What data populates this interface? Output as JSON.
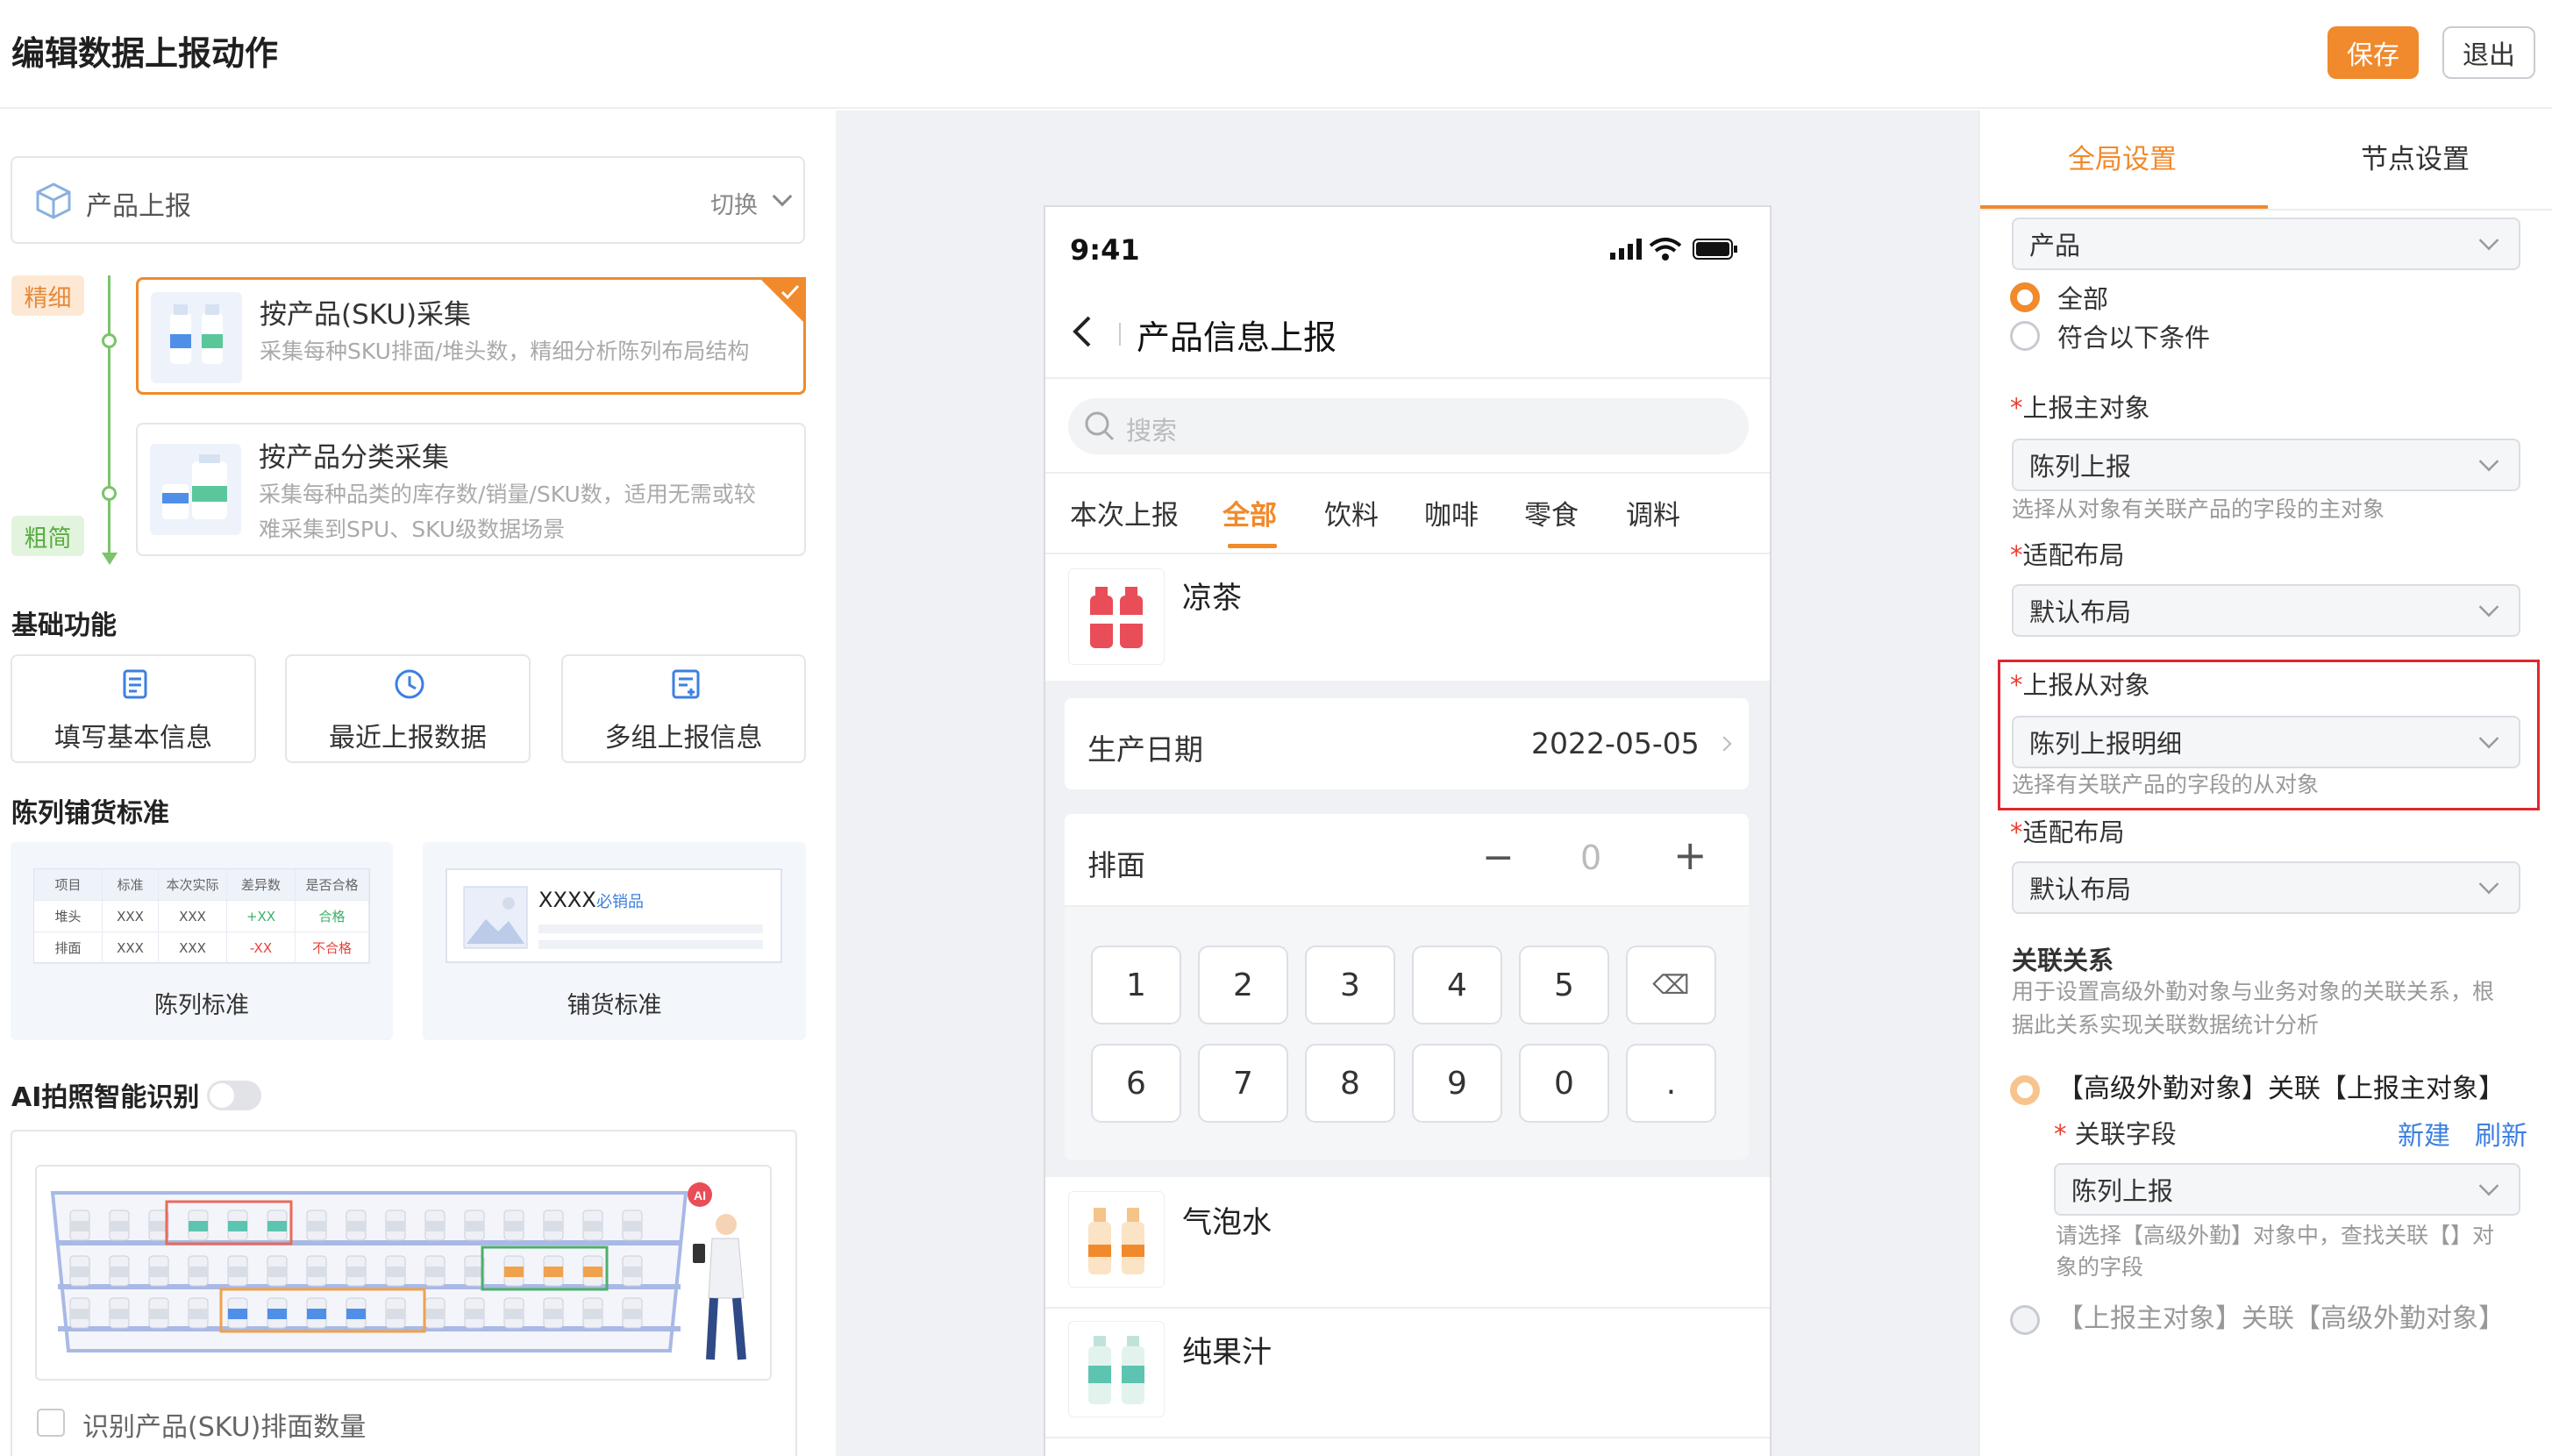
{
  "header": {
    "title": "编辑数据上报动作",
    "save": "保存",
    "exit": "退出"
  },
  "left": {
    "module": {
      "name": "产品上报",
      "switch": "切换"
    },
    "tag_fine": "精细",
    "tag_coarse": "粗简",
    "options": [
      {
        "title": "按产品(SKU)采集",
        "desc": "采集每种SKU排面/堆头数，精细分析陈列布局结构"
      },
      {
        "title": "按产品分类采集",
        "desc1": "采集每种品类的库存数/销量/SKU数，适用无需或较",
        "desc2": "难采集到SPU、SKU级数据场景"
      }
    ],
    "basic_title": "基础功能",
    "basic_buttons": [
      "填写基本信息",
      "最近上报数据",
      "多组上报信息"
    ],
    "display_title": "陈列铺货标准",
    "std_table": {
      "headers": [
        "项目",
        "标准",
        "本次实际",
        "差异数",
        "是否合格"
      ],
      "rows": [
        [
          "堆头",
          "XXX",
          "XXX",
          "+XX",
          "合格"
        ],
        [
          "排面",
          "XXX",
          "XXX",
          "-XX",
          "不合格"
        ]
      ]
    },
    "std_cards": [
      "陈列标准",
      "铺货标准"
    ],
    "dist_item": "XXXX",
    "dist_badge": "必销品",
    "ai_title": "AI拍照智能识别",
    "ai_badge": "AI",
    "ai_checkbox": "识别产品(SKU)排面数量"
  },
  "phone": {
    "time": "9:41",
    "title": "产品信息上报",
    "search_placeholder": "搜索",
    "tabs": [
      "本次上报",
      "全部",
      "饮料",
      "咖啡",
      "零食",
      "调料"
    ],
    "product1": "凉茶",
    "date_label": "生产日期",
    "date_value": "2022-05-05",
    "face_label": "排面",
    "face_value": "0",
    "minus": "−",
    "plus": "+",
    "keys": [
      "1",
      "2",
      "3",
      "4",
      "5",
      "⌫",
      "6",
      "7",
      "8",
      "9",
      "0",
      "."
    ],
    "product2": "气泡水",
    "product3": "纯果汁"
  },
  "right": {
    "tabs": [
      "全局设置",
      "节点设置"
    ],
    "product_select": "产品",
    "radio_all": "全部",
    "radio_cond": "符合以下条件",
    "main_obj_label": "上报主对象",
    "main_obj_value": "陈列上报",
    "main_obj_hint": "选择从对象有关联产品的字段的主对象",
    "layout_label": "适配布局",
    "layout_value": "默认布局",
    "sub_obj_label": "上报从对象",
    "sub_obj_value": "陈列上报明细",
    "sub_obj_hint": "选择有关联产品的字段的从对象",
    "layout2_label": "适配布局",
    "layout2_value": "默认布局",
    "rel_title": "关联关系",
    "rel_hint1": "用于设置高级外勤对象与业务对象的关联关系，根",
    "rel_hint2": "据此关系实现关联数据统计分析",
    "rel_opt1": "【高级外勤对象】关联【上报主对象】",
    "rel_field": "关联字段",
    "rel_new": "新建",
    "rel_refresh": "刷新",
    "rel_field_value": "陈列上报",
    "rel_field_hint1": "请选择【高级外勤】对象中，查找关联【】对",
    "rel_field_hint2": "象的字段",
    "rel_opt2": "【上报主对象】关联【高级外勤对象】",
    "accent": "#f08a2c",
    "highlight": "#e0262e"
  }
}
